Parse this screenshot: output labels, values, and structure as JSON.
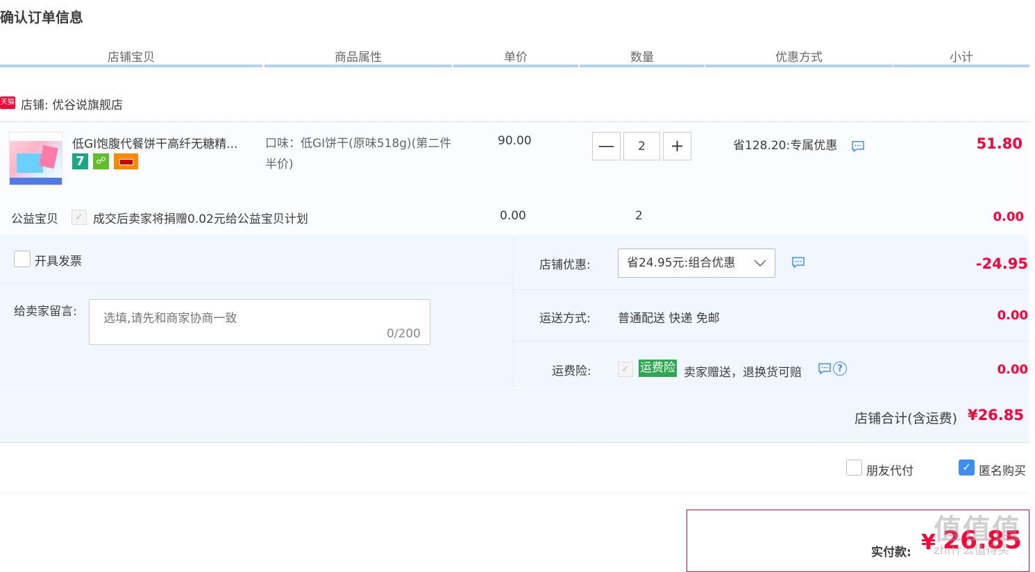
{
  "page_title": "确认订单信息",
  "columns": [
    "店铺宝贝",
    "商品属性",
    "单价",
    "数量",
    "优惠方式",
    "小计"
  ],
  "shop": {
    "badge": "天猫",
    "name_label": "店铺: 优谷说旗舰店"
  },
  "item": {
    "title": "低GI饱腹代餐饼干高纤无糖精...",
    "badges": [
      "7"
    ],
    "attr": "口味：低GI饼干(原味518g)(第二件半价)",
    "price": "90.00",
    "qty": "2",
    "qty_minus": "—",
    "qty_plus": "+",
    "discount": "省128.20:专属优惠",
    "subtotal": "51.80"
  },
  "charity": {
    "label": "公益宝贝",
    "text": "成交后卖家将捐赠0.02元给公益宝贝计划",
    "price": "0.00",
    "qty": "2",
    "subtotal": "0.00"
  },
  "invoice": {
    "label": "开具发票"
  },
  "message": {
    "label": "给卖家留言:",
    "placeholder": "选填,请先和商家协商一致",
    "counter": "0/200"
  },
  "shop_discount": {
    "label": "店铺优惠:",
    "selected": "省24.95元:组合优惠",
    "value": "-24.95"
  },
  "shipping": {
    "label": "运送方式:",
    "method": "普通配送 快递 免邮",
    "value": "0.00"
  },
  "insurance": {
    "label": "运费险:",
    "badge": "运费险",
    "text": "卖家赠送，退换货可赔",
    "value": "0.00"
  },
  "shop_total": {
    "label": "店铺合计(含运费)",
    "value": "¥26.85"
  },
  "options": {
    "friend_pay": "朋友代付",
    "anonymous": "匿名购买",
    "anonymous_checked": true
  },
  "payment": {
    "label": "实付款:",
    "yen": "¥",
    "amount": "26.85"
  },
  "watermark": {
    "glyphs": "值值值",
    "url": "zhi什么值得买"
  },
  "colors": {
    "accent_red": "#ff0036",
    "header_underline": "#b2d1ff",
    "panel_bg": "#f2f7ff",
    "green_badge": "#2aa94f",
    "blue_check": "#3c8ef0"
  }
}
